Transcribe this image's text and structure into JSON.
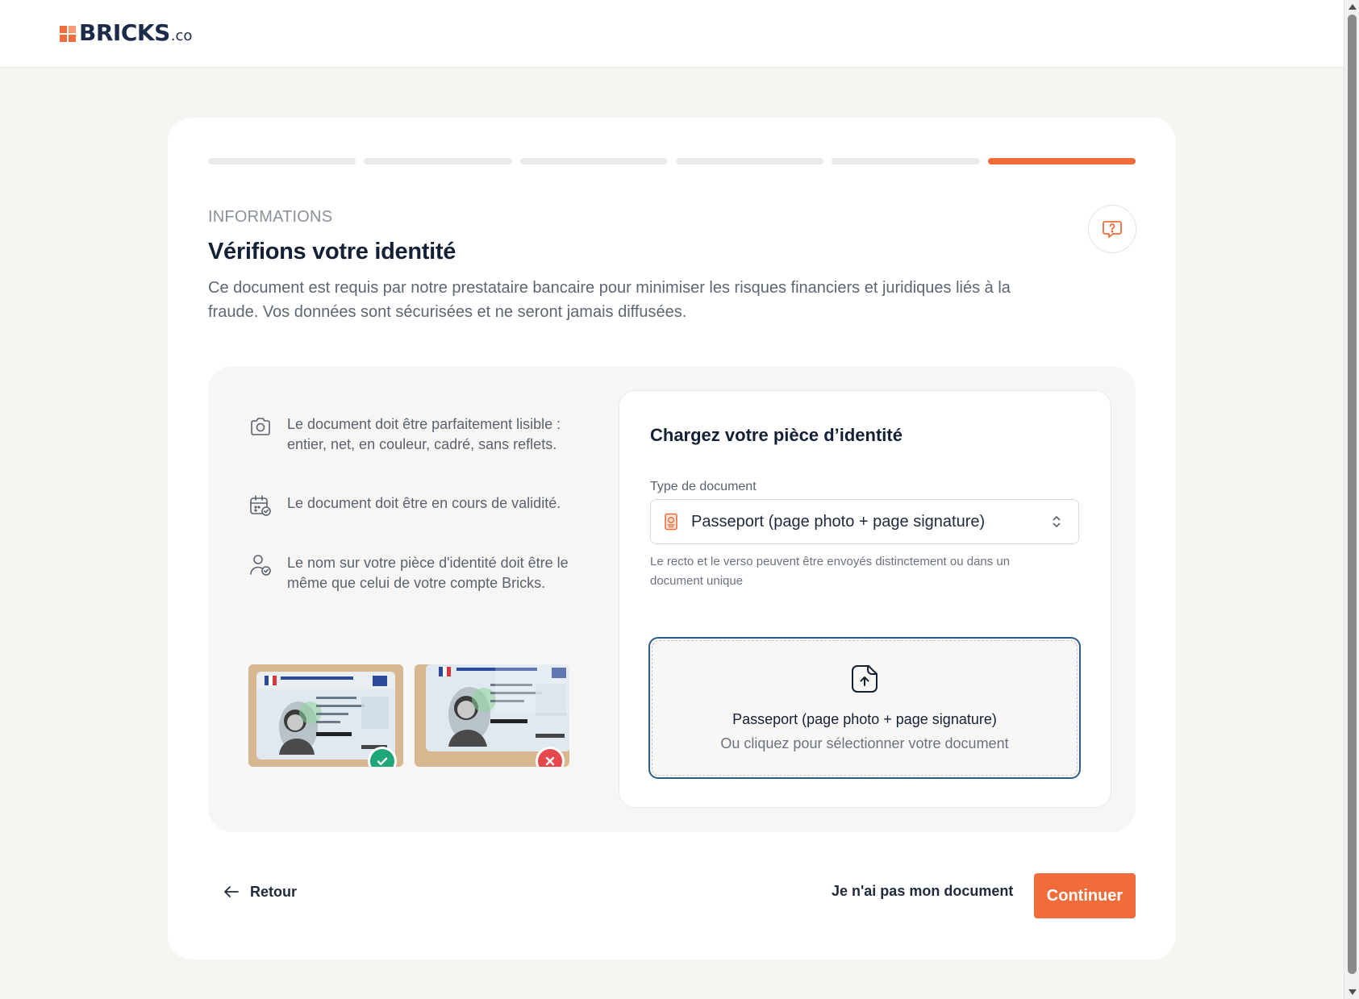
{
  "brand": {
    "name": "BRICKS",
    "suffix": ".co",
    "accent": "#f26b3a"
  },
  "progress": {
    "steps": 6,
    "current": 6
  },
  "header": {
    "eyebrow": "INFORMATIONS",
    "title": "Vérifions votre identité",
    "description": "Ce document est requis par notre prestataire bancaire pour minimiser les risques financiers et juridiques liés à la fraude. Vos données sont sécurisées et ne seront jamais diffusées.",
    "help_icon": "help-chat-icon"
  },
  "requirements": [
    {
      "icon": "camera-icon",
      "text": "Le document doit être parfaitement lisible : entier, net, en couleur, cadré, sans reflets."
    },
    {
      "icon": "calendar-check-icon",
      "text": "Le document doit être en cours de validité."
    },
    {
      "icon": "user-check-icon",
      "text": "Le nom sur votre pièce d'identité doit être le même que celui de votre compte Bricks."
    }
  ],
  "samples": [
    {
      "status": "valid",
      "badge_color": "#1fa67a",
      "icon": "check-icon"
    },
    {
      "status": "invalid",
      "badge_color": "#e5484d",
      "icon": "close-icon"
    }
  ],
  "upload": {
    "title": "Chargez votre pièce d’identité",
    "field_label": "Type de document",
    "selected_type": "Passeport (page photo + page signature)",
    "hint": "Le recto et le verso peuvent être envoyés distinctement ou dans un document unique",
    "dropzone_title": "Passeport (page photo + page signature)",
    "dropzone_subtitle": "Ou cliquez pour sélectionner votre document"
  },
  "footer": {
    "back_label": "Retour",
    "no_document_label": "Je n'ai pas mon document",
    "continue_label": "Continuer"
  }
}
